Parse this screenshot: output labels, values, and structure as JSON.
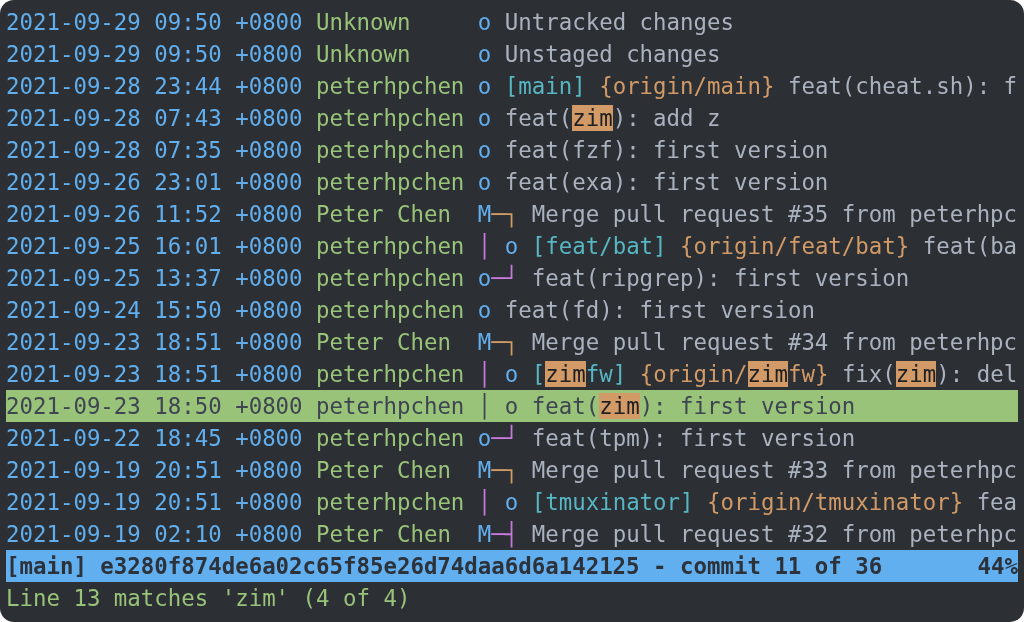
{
  "commits": [
    {
      "date": "2021-09-29 09:50 +0800",
      "author": "Unknown",
      "selected": false,
      "graph": [
        {
          "text": "o",
          "color": "#61afef"
        }
      ],
      "message": [
        {
          "kind": "text",
          "text": "Untracked changes"
        }
      ]
    },
    {
      "date": "2021-09-29 09:50 +0800",
      "author": "Unknown",
      "selected": false,
      "graph": [
        {
          "text": "o",
          "color": "#61afef"
        }
      ],
      "message": [
        {
          "kind": "text",
          "text": "Unstaged changes"
        }
      ]
    },
    {
      "date": "2021-09-28 23:44 +0800",
      "author": "peterhpchen",
      "selected": false,
      "graph": [
        {
          "text": "o",
          "color": "#61afef"
        }
      ],
      "message": [
        {
          "kind": "branch",
          "text": "[main]"
        },
        {
          "kind": "remote",
          "text": " {origin/main}"
        },
        {
          "kind": "text",
          "text": " feat(cheat.sh): f"
        }
      ]
    },
    {
      "date": "2021-09-28 07:43 +0800",
      "author": "peterhpchen",
      "selected": false,
      "graph": [
        {
          "text": "o",
          "color": "#61afef"
        }
      ],
      "message": [
        {
          "kind": "text",
          "text": "feat("
        },
        {
          "kind": "match",
          "text": "zim"
        },
        {
          "kind": "text",
          "text": "): add z"
        }
      ]
    },
    {
      "date": "2021-09-28 07:35 +0800",
      "author": "peterhpchen",
      "selected": false,
      "graph": [
        {
          "text": "o",
          "color": "#61afef"
        }
      ],
      "message": [
        {
          "kind": "text",
          "text": "feat(fzf): first version"
        }
      ]
    },
    {
      "date": "2021-09-26 23:01 +0800",
      "author": "peterhpchen",
      "selected": false,
      "graph": [
        {
          "text": "o",
          "color": "#61afef"
        }
      ],
      "message": [
        {
          "kind": "text",
          "text": "feat(exa): first version"
        }
      ]
    },
    {
      "date": "2021-09-26 11:52 +0800",
      "author": "Peter Chen",
      "selected": false,
      "graph": [
        {
          "text": "M",
          "color": "#61afef"
        },
        {
          "text": "─┐",
          "color": "#d19a66"
        }
      ],
      "message": [
        {
          "kind": "text",
          "text": "Merge pull request #35 from peterhpc"
        }
      ]
    },
    {
      "date": "2021-09-25 16:01 +0800",
      "author": "peterhpchen",
      "selected": false,
      "graph": [
        {
          "text": "│",
          "color": "#c678dd"
        },
        {
          "text": " o",
          "color": "#61afef"
        }
      ],
      "message": [
        {
          "kind": "branch",
          "text": "[feat/bat]"
        },
        {
          "kind": "remote",
          "text": " {origin/feat/bat}"
        },
        {
          "kind": "text",
          "text": " feat(ba"
        }
      ]
    },
    {
      "date": "2021-09-25 13:37 +0800",
      "author": "peterhpchen",
      "selected": false,
      "graph": [
        {
          "text": "o",
          "color": "#61afef"
        },
        {
          "text": "─┘",
          "color": "#c678dd"
        }
      ],
      "message": [
        {
          "kind": "text",
          "text": "feat(ripgrep): first version"
        }
      ]
    },
    {
      "date": "2021-09-24 15:50 +0800",
      "author": "peterhpchen",
      "selected": false,
      "graph": [
        {
          "text": "o",
          "color": "#61afef"
        }
      ],
      "message": [
        {
          "kind": "text",
          "text": "feat(fd): first version"
        }
      ]
    },
    {
      "date": "2021-09-23 18:51 +0800",
      "author": "Peter Chen",
      "selected": false,
      "graph": [
        {
          "text": "M",
          "color": "#61afef"
        },
        {
          "text": "─┐",
          "color": "#d19a66"
        }
      ],
      "message": [
        {
          "kind": "text",
          "text": "Merge pull request #34 from peterhpc"
        }
      ]
    },
    {
      "date": "2021-09-23 18:51 +0800",
      "author": "peterhpchen",
      "selected": false,
      "graph": [
        {
          "text": "│",
          "color": "#c678dd"
        },
        {
          "text": " o",
          "color": "#61afef"
        }
      ],
      "message": [
        {
          "kind": "branch",
          "text": "["
        },
        {
          "kind": "match",
          "text": "zim"
        },
        {
          "kind": "branch",
          "text": "fw]"
        },
        {
          "kind": "remote",
          "text": " {origin/"
        },
        {
          "kind": "match",
          "text": "zim"
        },
        {
          "kind": "remote",
          "text": "fw}"
        },
        {
          "kind": "text",
          "text": " fix("
        },
        {
          "kind": "match",
          "text": "zim"
        },
        {
          "kind": "text",
          "text": "): del"
        }
      ]
    },
    {
      "date": "2021-09-23 18:50 +0800",
      "author": "peterhpchen",
      "selected": true,
      "graph": [
        {
          "text": "│",
          "color": "#3e4451"
        },
        {
          "text": " o",
          "color": "#3e4451"
        }
      ],
      "message": [
        {
          "kind": "text",
          "text": "feat("
        },
        {
          "kind": "match",
          "text": "zim"
        },
        {
          "kind": "text",
          "text": "): first version"
        }
      ]
    },
    {
      "date": "2021-09-22 18:45 +0800",
      "author": "peterhpchen",
      "selected": false,
      "graph": [
        {
          "text": "o",
          "color": "#61afef"
        },
        {
          "text": "─┘",
          "color": "#c678dd"
        }
      ],
      "message": [
        {
          "kind": "text",
          "text": "feat(tpm): first version"
        }
      ]
    },
    {
      "date": "2021-09-19 20:51 +0800",
      "author": "Peter Chen",
      "selected": false,
      "graph": [
        {
          "text": "M",
          "color": "#61afef"
        },
        {
          "text": "─┐",
          "color": "#d19a66"
        }
      ],
      "message": [
        {
          "kind": "text",
          "text": "Merge pull request #33 from peterhpc"
        }
      ]
    },
    {
      "date": "2021-09-19 20:51 +0800",
      "author": "peterhpchen",
      "selected": false,
      "graph": [
        {
          "text": "│",
          "color": "#c678dd"
        },
        {
          "text": " o",
          "color": "#61afef"
        }
      ],
      "message": [
        {
          "kind": "branch",
          "text": "[tmuxinator]"
        },
        {
          "kind": "remote",
          "text": " {origin/tmuxinator}"
        },
        {
          "kind": "text",
          "text": " fea"
        }
      ]
    },
    {
      "date": "2021-09-19 02:10 +0800",
      "author": "Peter Chen",
      "selected": false,
      "graph": [
        {
          "text": "M",
          "color": "#61afef"
        },
        {
          "text": "─┤",
          "color": "#c678dd"
        }
      ],
      "message": [
        {
          "kind": "text",
          "text": "Merge pull request #32 from peterhpc"
        }
      ]
    }
  ],
  "status_bar": {
    "text": "[main] e3280f874de6a02c65f85e26d74daa6d6a142125 - commit 11 of 36",
    "percent": "44%"
  },
  "message_line": "Line 13 matches 'zim' (4 of 4)"
}
